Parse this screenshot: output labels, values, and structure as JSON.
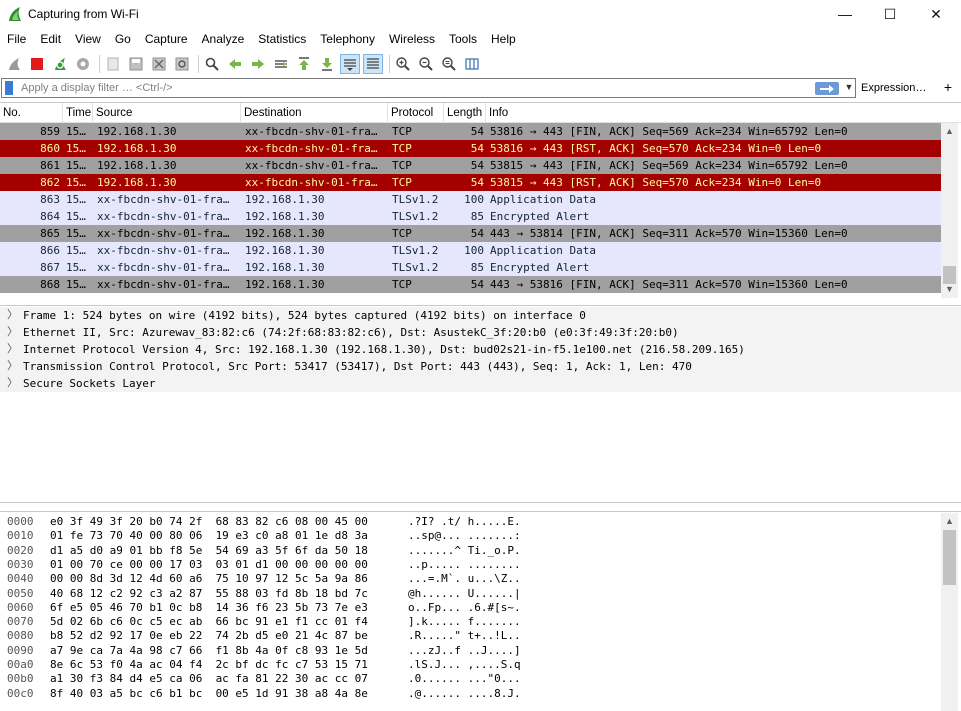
{
  "window": {
    "title": "Capturing from Wi-Fi",
    "minimize": "—",
    "maximize": "☐",
    "close": "✕"
  },
  "menu": [
    "File",
    "Edit",
    "View",
    "Go",
    "Capture",
    "Analyze",
    "Statistics",
    "Telephony",
    "Wireless",
    "Tools",
    "Help"
  ],
  "toolbar": {
    "buttons": [
      "start-capture-icon",
      "stop-capture-icon",
      "restart-capture-icon",
      "capture-options-icon",
      "open-file-icon",
      "save-file-icon",
      "close-file-icon",
      "reload-file-icon",
      "find-packet-icon",
      "go-back-icon",
      "go-forward-icon",
      "go-to-packet-icon",
      "go-first-icon",
      "go-last-icon",
      "autoscroll-icon",
      "colorize-icon",
      "zoom-in-icon",
      "zoom-out-icon",
      "zoom-normal-icon",
      "resize-columns-icon"
    ]
  },
  "filter": {
    "placeholder": "Apply a display filter … <Ctrl-/>",
    "value": "",
    "expression_label": "Expression…",
    "add_label": "+"
  },
  "packet_list": {
    "columns": [
      "No.",
      "Time",
      "Source",
      "Destination",
      "Protocol",
      "Length",
      "Info"
    ],
    "rows": [
      {
        "no": "859",
        "time": "15…",
        "source": "192.168.1.30",
        "destination": "xx-fbcdn-shv-01-fra…",
        "protocol": "TCP",
        "length": "54",
        "info": "53816 → 443 [FIN, ACK] Seq=569 Ack=234 Win=65792 Len=0",
        "style": "gray"
      },
      {
        "no": "860",
        "time": "15…",
        "source": "192.168.1.30",
        "destination": "xx-fbcdn-shv-01-fra…",
        "protocol": "TCP",
        "length": "54",
        "info": "53816 → 443 [RST, ACK] Seq=570 Ack=234 Win=0 Len=0",
        "style": "red"
      },
      {
        "no": "861",
        "time": "15…",
        "source": "192.168.1.30",
        "destination": "xx-fbcdn-shv-01-fra…",
        "protocol": "TCP",
        "length": "54",
        "info": "53815 → 443 [FIN, ACK] Seq=569 Ack=234 Win=65792 Len=0",
        "style": "gray"
      },
      {
        "no": "862",
        "time": "15…",
        "source": "192.168.1.30",
        "destination": "xx-fbcdn-shv-01-fra…",
        "protocol": "TCP",
        "length": "54",
        "info": "53815 → 443 [RST, ACK] Seq=570 Ack=234 Win=0 Len=0",
        "style": "red"
      },
      {
        "no": "863",
        "time": "15…",
        "source": "xx-fbcdn-shv-01-fra…",
        "destination": "192.168.1.30",
        "protocol": "TLSv1.2",
        "length": "100",
        "info": "Application Data",
        "style": "lavender"
      },
      {
        "no": "864",
        "time": "15…",
        "source": "xx-fbcdn-shv-01-fra…",
        "destination": "192.168.1.30",
        "protocol": "TLSv1.2",
        "length": "85",
        "info": "Encrypted Alert",
        "style": "lavender"
      },
      {
        "no": "865",
        "time": "15…",
        "source": "xx-fbcdn-shv-01-fra…",
        "destination": "192.168.1.30",
        "protocol": "TCP",
        "length": "54",
        "info": "443 → 53814 [FIN, ACK] Seq=311 Ack=570 Win=15360 Len=0",
        "style": "gray"
      },
      {
        "no": "866",
        "time": "15…",
        "source": "xx-fbcdn-shv-01-fra…",
        "destination": "192.168.1.30",
        "protocol": "TLSv1.2",
        "length": "100",
        "info": "Application Data",
        "style": "lavender"
      },
      {
        "no": "867",
        "time": "15…",
        "source": "xx-fbcdn-shv-01-fra…",
        "destination": "192.168.1.30",
        "protocol": "TLSv1.2",
        "length": "85",
        "info": "Encrypted Alert",
        "style": "lavender"
      },
      {
        "no": "868",
        "time": "15…",
        "source": "xx-fbcdn-shv-01-fra…",
        "destination": "192.168.1.30",
        "protocol": "TCP",
        "length": "54",
        "info": "443 → 53816 [FIN, ACK] Seq=311 Ack=570 Win=15360 Len=0",
        "style": "gray"
      }
    ]
  },
  "row_colors": {
    "gray": {
      "bg": "#a0a0a0",
      "fg": "#000000"
    },
    "red": {
      "bg": "#a40000",
      "fg": "#fffc9c"
    },
    "lavender": {
      "bg": "#e7e6ff",
      "fg": "#12272e"
    }
  },
  "details": [
    "Frame 1: 524 bytes on wire (4192 bits), 524 bytes captured (4192 bits) on interface 0",
    "Ethernet II, Src: Azurewav_83:82:c6 (74:2f:68:83:82:c6), Dst: AsustekC_3f:20:b0 (e0:3f:49:3f:20:b0)",
    "Internet Protocol Version 4, Src: 192.168.1.30 (192.168.1.30), Dst: bud02s21-in-f5.1e100.net (216.58.209.165)",
    "Transmission Control Protocol, Src Port: 53417 (53417), Dst Port: 443 (443), Seq: 1, Ack: 1, Len: 470",
    "Secure Sockets Layer"
  ],
  "bytes": [
    {
      "offset": "0000",
      "hex": "e0 3f 49 3f 20 b0 74 2f  68 83 82 c6 08 00 45 00",
      "ascii": ".?I? .t/ h.....E."
    },
    {
      "offset": "0010",
      "hex": "01 fe 73 70 40 00 80 06  19 e3 c0 a8 01 1e d8 3a",
      "ascii": "..sp@... .......:"
    },
    {
      "offset": "0020",
      "hex": "d1 a5 d0 a9 01 bb f8 5e  54 69 a3 5f 6f da 50 18",
      "ascii": ".......^ Ti._o.P."
    },
    {
      "offset": "0030",
      "hex": "01 00 70 ce 00 00 17 03  03 01 d1 00 00 00 00 00",
      "ascii": "..p..... ........"
    },
    {
      "offset": "0040",
      "hex": "00 00 8d 3d 12 4d 60 a6  75 10 97 12 5c 5a 9a 86",
      "ascii": "...=.M`. u...\\Z.."
    },
    {
      "offset": "0050",
      "hex": "40 68 12 c2 92 c3 a2 87  55 88 03 fd 8b 18 bd 7c",
      "ascii": "@h...... U......|"
    },
    {
      "offset": "0060",
      "hex": "6f e5 05 46 70 b1 0c b8  14 36 f6 23 5b 73 7e e3",
      "ascii": "o..Fp... .6.#[s~."
    },
    {
      "offset": "0070",
      "hex": "5d 02 6b c6 0c c5 ec ab  66 bc 91 e1 f1 cc 01 f4",
      "ascii": "].k..... f......."
    },
    {
      "offset": "0080",
      "hex": "b8 52 d2 92 17 0e eb 22  74 2b d5 e0 21 4c 87 be",
      "ascii": ".R.....\" t+..!L.."
    },
    {
      "offset": "0090",
      "hex": "a7 9e ca 7a 4a 98 c7 66  f1 8b 4a 0f c8 93 1e 5d",
      "ascii": "...zJ..f ..J....]"
    },
    {
      "offset": "00a0",
      "hex": "8e 6c 53 f0 4a ac 04 f4  2c bf dc fc c7 53 15 71",
      "ascii": ".lS.J... ,....S.q"
    },
    {
      "offset": "00b0",
      "hex": "a1 30 f3 84 d4 e5 ca 06  ac fa 81 22 30 ac cc 07",
      "ascii": ".0...... ...\"0..."
    },
    {
      "offset": "00c0",
      "hex": "8f 40 03 a5 bc c6 b1 bc  00 e5 1d 91 38 a8 4a 8e",
      "ascii": ".@...... ....8.J."
    }
  ]
}
